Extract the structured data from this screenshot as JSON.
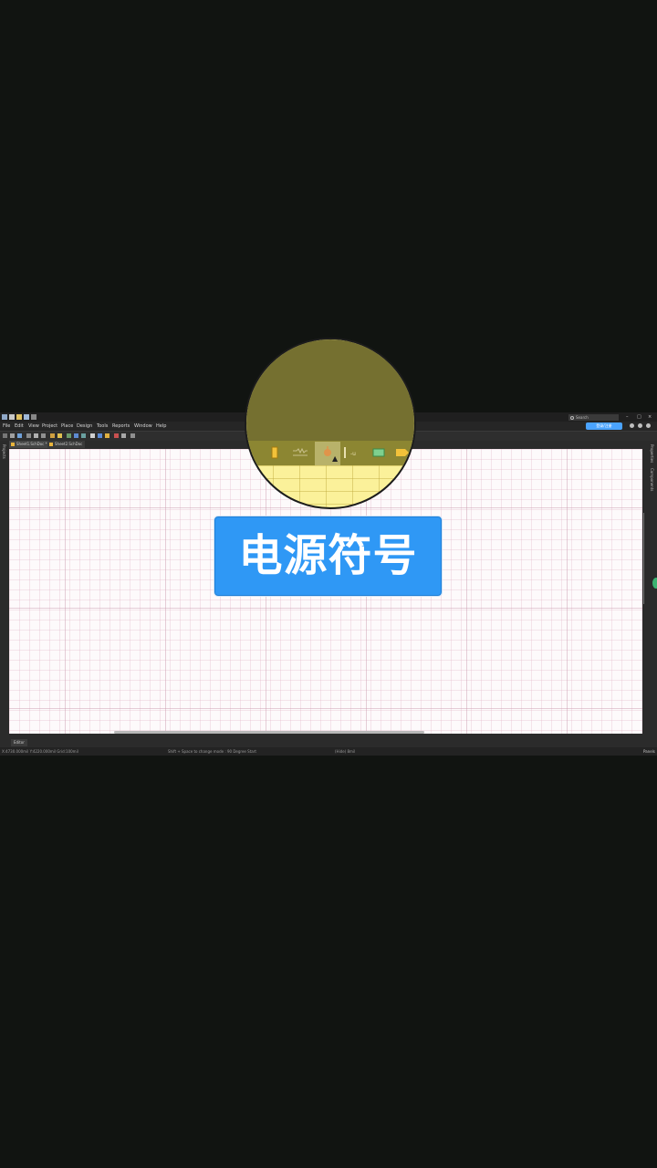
{
  "window": {
    "search_placeholder": "Search",
    "controls": [
      "–",
      "□",
      "×"
    ]
  },
  "menu": {
    "items": [
      "File",
      "Edit",
      "View",
      "Project",
      "Place",
      "Design",
      "Tools",
      "Reports",
      "Window",
      "Help"
    ],
    "signin_label": "登录/注册"
  },
  "tabs": [
    {
      "label": "Sheet1.SchDoc *",
      "active": true
    },
    {
      "label": "Sheet2.SchDoc",
      "active": false
    }
  ],
  "side_panels": {
    "left": "Projects",
    "right": [
      "Properties",
      "Components"
    ]
  },
  "overlay": {
    "caption": "电源符号",
    "icons": [
      "ic-bar-icon",
      "resistor-icon",
      "power-port-icon",
      "netlabel-icon",
      "ic-chip-icon",
      "port-icon"
    ]
  },
  "bottom": {
    "panel_tab": "Editor",
    "status_left": "X:4730.000mil Y:4220.000mil   Grid:100mil",
    "status_center": "Shift + Space to change mode : 90 Degree Start",
    "status_right": "(Hide) 8mil",
    "panels_button": "Panels"
  },
  "colors": {
    "banner": "#2f98f5",
    "magnifier": "#fbf19a",
    "app_background": "#2b2b2b",
    "canvas": "#fdfafb"
  }
}
